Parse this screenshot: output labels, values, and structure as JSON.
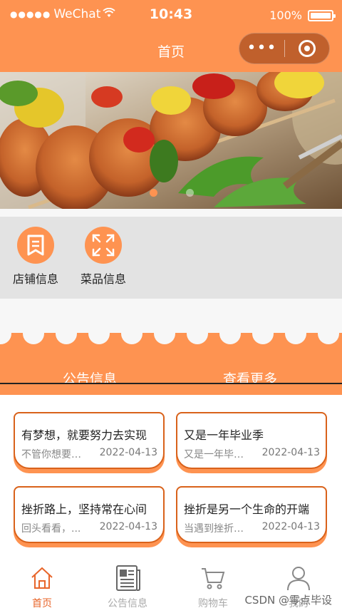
{
  "status_bar": {
    "dots": "●●●●●",
    "carrier": "WeChat",
    "time": "10:43",
    "battery": "100%"
  },
  "nav": {
    "title": "首页",
    "more": "•••"
  },
  "menu": [
    {
      "label": "店铺信息",
      "icon": "document-icon"
    },
    {
      "label": "菜品信息",
      "icon": "expand-icon"
    }
  ],
  "notice": {
    "title": "公告信息",
    "more": "查看更多"
  },
  "cards": [
    {
      "title": "有梦想，就要努力去实现",
      "subtitle": "不管你想要怎样的生活",
      "date": "2022-04-13"
    },
    {
      "title": "又是一年毕业季",
      "subtitle": "又是一年毕业季",
      "date": "2022-04-13"
    },
    {
      "title": "挫折路上，坚持常在心间",
      "subtitle": "回头看看，...",
      "date": "2022-04-13"
    },
    {
      "title": "挫折是另一个生命的开端",
      "subtitle": "当遇到挫折的时候",
      "date": "2022-04-13"
    }
  ],
  "tabs": [
    {
      "label": "首页",
      "icon": "home-icon",
      "active": true
    },
    {
      "label": "公告信息",
      "icon": "newspaper-icon",
      "active": false
    },
    {
      "label": "购物车",
      "icon": "cart-icon",
      "active": false
    },
    {
      "label": "我的",
      "icon": "user-icon",
      "active": false
    }
  ],
  "watermark": "CSDN @零点毕设",
  "colors": {
    "primary": "#fe9351",
    "card_border": "#d9621b",
    "active_tab": "#e8652a",
    "menu_bg": "#e3e3e3"
  }
}
